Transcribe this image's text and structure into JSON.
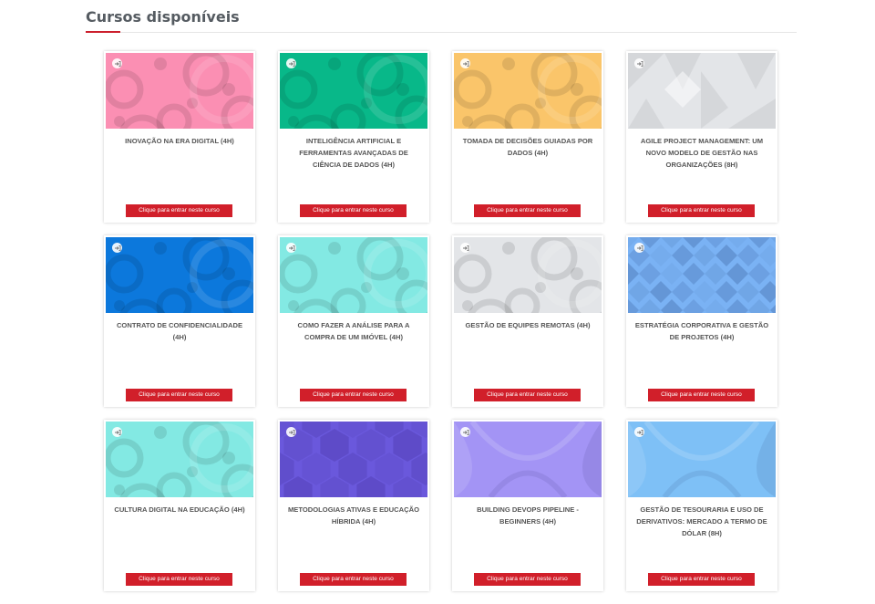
{
  "page": {
    "title": "Cursos disponíveis"
  },
  "brand": {
    "accent": "#cc1f2d",
    "button": "#d11f2a"
  },
  "courses": [
    {
      "title": "INOVAÇÃO NA ERA DIGITAL (4H)",
      "button": "Clique para entrar neste curso",
      "color": "#fb8fb3",
      "pattern": "circles"
    },
    {
      "title": "INTELIGÊNCIA ARTIFICIAL E FERRAMENTAS AVANÇADAS DE CIÊNCIA DE DADOS (4H)",
      "button": "Clique para entrar neste curso",
      "color": "#08b889",
      "pattern": "circles"
    },
    {
      "title": "TOMADA DE DECISÕES GUIADAS POR DADOS (4H)",
      "button": "Clique para entrar neste curso",
      "color": "#fac56a",
      "pattern": "circles"
    },
    {
      "title": "AGILE PROJECT MANAGEMENT: UM NOVO MODELO DE GESTÃO NAS ORGANIZAÇÕES (8H)",
      "button": "Clique para entrar neste curso",
      "color": "#e3e5e8",
      "pattern": "triangles"
    },
    {
      "title": "CONTRATO DE CONFIDENCIALIDADE (4H)",
      "button": "Clique para entrar neste curso",
      "color": "#0c78dc",
      "pattern": "circles"
    },
    {
      "title": "COMO FAZER A ANÁLISE PARA A COMPRA DE UM IMÓVEL (4H)",
      "button": "Clique para entrar neste curso",
      "color": "#83e9e3",
      "pattern": "circles"
    },
    {
      "title": "GESTÃO DE EQUIPES REMOTAS (4H)",
      "button": "Clique para entrar neste curso",
      "color": "#e3e5e8",
      "pattern": "circles"
    },
    {
      "title": "ESTRATÉGIA CORPORATIVA E GESTÃO DE PROJETOS (4H)",
      "button": "Clique para entrar neste curso",
      "color": "#7ab2f4",
      "pattern": "diamonds"
    },
    {
      "title": "CULTURA DIGITAL NA EDUCAÇÃO (4H)",
      "button": "Clique para entrar neste curso",
      "color": "#83e9e3",
      "pattern": "circles"
    },
    {
      "title": "METODOLOGIAS ATIVAS E EDUCAÇÃO HÍBRIDA (4H)",
      "button": "Clique para entrar neste curso",
      "color": "#6a58dc",
      "pattern": "hexagons"
    },
    {
      "title": "BUILDING DEVOPS PIPELINE - BEGINNERS (4H)",
      "button": "Clique para entrar neste curso",
      "color": "#a394f5",
      "pattern": "waves"
    },
    {
      "title": "GESTÃO DE TESOURARIA E USO DE DERIVATIVOS: MERCADO A TERMO DE DÓLAR (8H)",
      "button": "Clique para entrar neste curso",
      "color": "#7ec0f6",
      "pattern": "waves"
    }
  ]
}
